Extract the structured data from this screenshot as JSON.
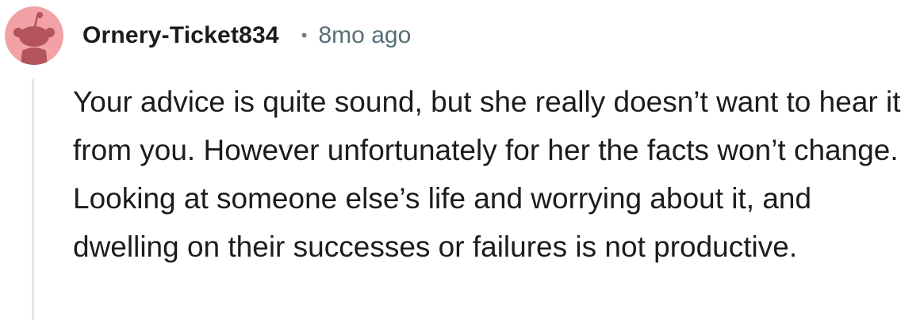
{
  "comment": {
    "avatar_icon": "reddit-snoo-avatar-icon",
    "avatar_colors": {
      "background": "#f2a2a6",
      "figure": "#b3545b"
    },
    "username": "Ornery-Ticket834",
    "separator": "•",
    "timestamp": "8mo ago",
    "body": "Your advice is quite sound, but she really doesn’t want to hear it from you. However unfortunately for her the facts won’t change. Looking at someone else’s life and worrying about it, and dwelling on their successes or failures is not productive."
  }
}
